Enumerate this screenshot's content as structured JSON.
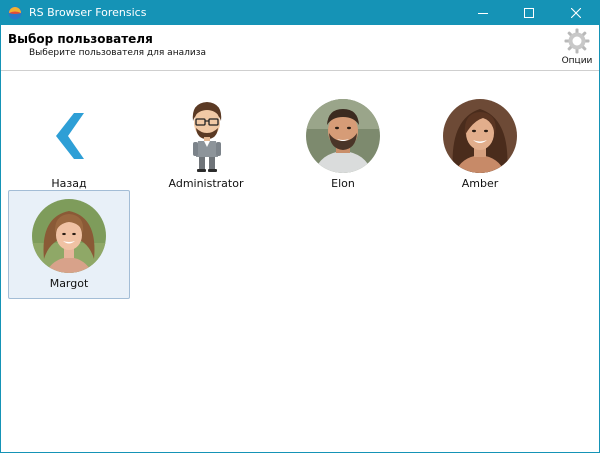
{
  "window": {
    "title": "RS Browser Forensics",
    "accent_color": "#1593b6",
    "controls": [
      "minimize-icon",
      "maximize-icon",
      "close-icon"
    ]
  },
  "header": {
    "title": "Выбор пользователя",
    "subtitle": "Выберите пользователя для анализа",
    "options_label": "Опции",
    "options_icon": "gear-icon"
  },
  "tiles": [
    {
      "label": "Назад",
      "icon": "chevron-left-icon",
      "color": "#2e9fd6"
    },
    {
      "label": "Administrator",
      "icon": "cartoon-avatar"
    },
    {
      "label": "Elon",
      "icon": "user-photo"
    },
    {
      "label": "Amber",
      "icon": "user-photo"
    },
    {
      "label": "Margot",
      "icon": "user-photo",
      "selected": true
    }
  ]
}
